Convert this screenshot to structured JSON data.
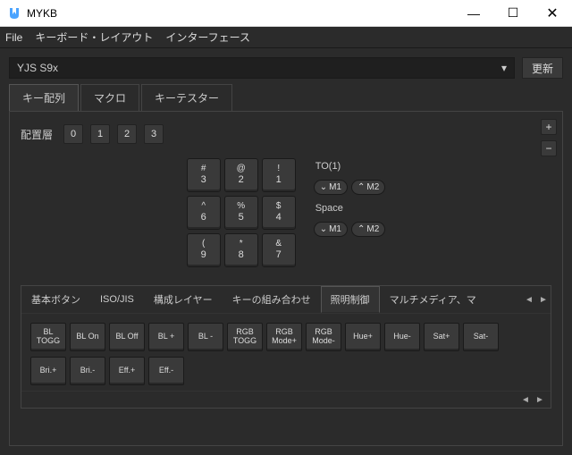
{
  "window": {
    "title": "MYKB"
  },
  "menu": {
    "file": "File",
    "layout": "キーボード・レイアウト",
    "interface": "インターフェース"
  },
  "device": {
    "selected": "YJS S9x",
    "update": "更新"
  },
  "tabs": {
    "keymap": "キー配列",
    "macro": "マクロ",
    "tester": "キーテスター"
  },
  "layer": {
    "label": "配置層",
    "b0": "0",
    "b1": "1",
    "b2": "2",
    "b3": "3"
  },
  "keys": [
    {
      "t": "#",
      "b": "3"
    },
    {
      "t": "@",
      "b": "2"
    },
    {
      "t": "!",
      "b": "1"
    },
    {
      "t": "^",
      "b": "6"
    },
    {
      "t": "%",
      "b": "5"
    },
    {
      "t": "$",
      "b": "4"
    },
    {
      "t": "(",
      "b": "9"
    },
    {
      "t": "*",
      "b": "8"
    },
    {
      "t": "&",
      "b": "7"
    }
  ],
  "right": {
    "to1": "TO(1)",
    "m1d": "M1",
    "m2u": "M2",
    "space": "Space",
    "m1d2": "M1",
    "m2u2": "M2"
  },
  "cat": {
    "basic": "基本ボタン",
    "iso": "ISO/JIS",
    "layers": "構成レイヤー",
    "combo": "キーの組み合わせ",
    "light": "照明制御",
    "media": "マルチメディア、マ"
  },
  "lbtns1": [
    "BL\nTOGG",
    "BL On",
    "BL Off",
    "BL +",
    "BL -",
    "RGB\nTOGG",
    "RGB\nMode+",
    "RGB\nMode-",
    "Hue+",
    "Hue-",
    "Sat+",
    "Sat-"
  ],
  "lbtns2": [
    "Bri.+",
    "Bri.-",
    "Eff.+",
    "Eff.-"
  ]
}
